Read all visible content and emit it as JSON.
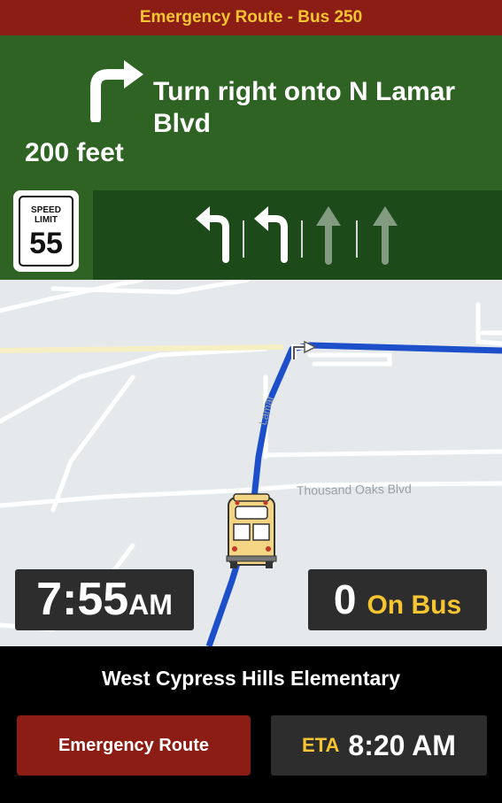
{
  "header": {
    "title": "Emergency Route - Bus 250"
  },
  "navigation": {
    "instruction": "Turn right onto N Lamar Blvd",
    "distance": "200 feet",
    "turn_icon": "turn-right-arrow",
    "speed_limit": {
      "label_line1": "SPEED",
      "label_line2": "LIMIT",
      "value": "55"
    },
    "lanes": [
      {
        "icon": "turn-left-lane-arrow",
        "active": true
      },
      {
        "icon": "turn-left-lane-arrow",
        "active": true
      },
      {
        "icon": "straight-lane-arrow",
        "active": false
      },
      {
        "icon": "straight-lane-arrow",
        "active": true
      }
    ]
  },
  "map": {
    "street_labels": [
      "Thousand Oaks Blvd",
      "Lamar"
    ],
    "route_color": "#1c4fc9",
    "vehicle_icon": "school-bus-icon"
  },
  "status": {
    "time": "7:55",
    "time_suffix": "AM",
    "bus_count": "0",
    "bus_label": "On Bus"
  },
  "footer": {
    "destination": "West Cypress Hills Elementary",
    "emergency_button": "Emergency Route",
    "eta_label": "ETA",
    "eta_time": "8:20 AM"
  },
  "colors": {
    "header_bg": "#8c1d14",
    "header_text": "#f7c531",
    "nav_bg": "#2e6324",
    "lane_bg": "#1d4a19",
    "panel_bg": "#2d2d2d",
    "accent_yellow": "#f7c531"
  }
}
